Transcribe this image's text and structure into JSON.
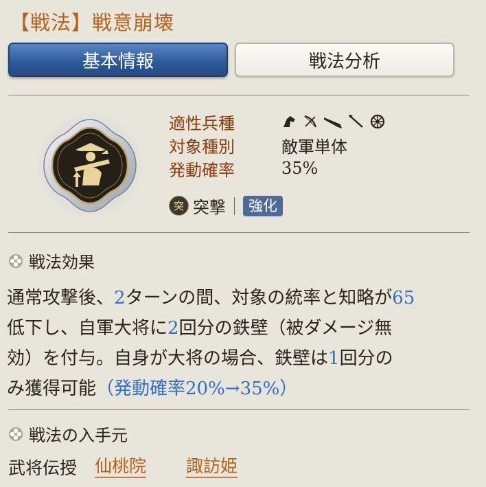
{
  "header": {
    "title": "【戦法】戦意崩壊"
  },
  "tabs": [
    {
      "label": "基本情報",
      "active": true
    },
    {
      "label": "戦法分析",
      "active": false
    }
  ],
  "stats": {
    "unit_type_label": "適性兵種",
    "unit_icons": [
      "cavalry-icon",
      "bow-icon",
      "gun-icon",
      "spear-icon",
      "wheel-icon"
    ],
    "target_label": "対象種別",
    "target_value": "敵軍単体",
    "rate_label": "発動確率",
    "rate_value": "35%"
  },
  "tags": {
    "type_icon": "突",
    "type_label": "突撃",
    "badge": "強化"
  },
  "effect": {
    "heading": "戦法効果",
    "lines": [
      [
        "通常攻撃後、",
        "2",
        "ターンの間、対象の統率と知略が",
        "65"
      ],
      [
        "低下し、自軍大将に",
        "2",
        "回分の鉄壁（被ダメージ無"
      ],
      [
        "効）を付与。自身が大将の場合、鉄壁は",
        "1",
        "回分の"
      ],
      [
        "み獲得可能",
        "（発動確率20%→35%）"
      ]
    ]
  },
  "source": {
    "heading": "戦法の入手元",
    "label": "武将伝授",
    "links": [
      "仙桃院",
      "諏訪姫"
    ]
  },
  "colors": {
    "title": "#b5621d",
    "label": "#8a3e0e",
    "highlight": "#2f6fce",
    "tab_active": "#2f5c9c",
    "background": "#e8e5da"
  }
}
